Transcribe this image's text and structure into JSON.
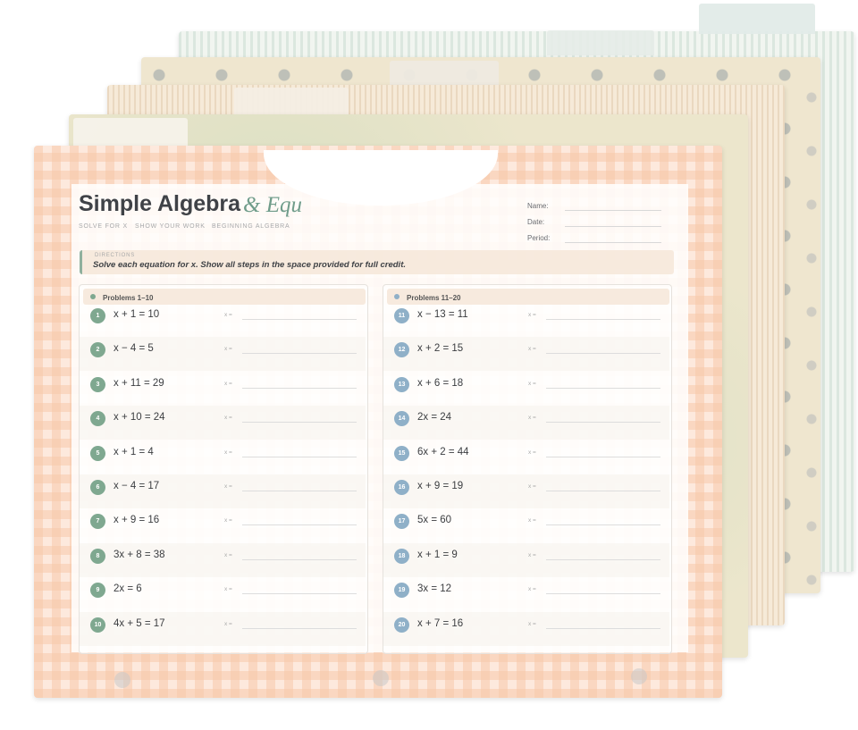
{
  "header": {
    "title": "Simple Algebra",
    "title_accent": "& Equ",
    "subtitle_items": [
      "Solve for x",
      "Show your work",
      "Beginning algebra"
    ],
    "fields": [
      "Name:",
      "Date:",
      "Period:"
    ]
  },
  "directions": {
    "label": "Directions",
    "text": "Solve each equation for x.  Show all steps in the space provided for full credit."
  },
  "colors": {
    "accent_green": "#7fa890",
    "accent_blue": "#8fb0c8"
  },
  "left_column": {
    "heading": "Problems 1–10",
    "problems": [
      {
        "n": "1",
        "eq": "x + 1 = 10",
        "answer_label": "x ="
      },
      {
        "n": "2",
        "eq": "x − 4 = 5",
        "answer_label": "x ="
      },
      {
        "n": "3",
        "eq": "x + 11 = 29",
        "answer_label": "x ="
      },
      {
        "n": "4",
        "eq": "x + 10 = 24",
        "answer_label": "x ="
      },
      {
        "n": "5",
        "eq": "x + 1 = 4",
        "answer_label": "x ="
      },
      {
        "n": "6",
        "eq": "x − 4 = 17",
        "answer_label": "x ="
      },
      {
        "n": "7",
        "eq": "x + 9 = 16",
        "answer_label": "x ="
      },
      {
        "n": "8",
        "eq": "3x + 8 = 38",
        "answer_label": "x ="
      },
      {
        "n": "9",
        "eq": "2x = 6",
        "answer_label": "x ="
      },
      {
        "n": "10",
        "eq": "4x + 5 = 17",
        "answer_label": "x ="
      }
    ]
  },
  "right_column": {
    "heading": "Problems 11–20",
    "problems": [
      {
        "n": "11",
        "eq": "x − 13 = 11",
        "answer_label": "x ="
      },
      {
        "n": "12",
        "eq": "x + 2 = 15",
        "answer_label": "x ="
      },
      {
        "n": "13",
        "eq": "x + 6 = 18",
        "answer_label": "x ="
      },
      {
        "n": "14",
        "eq": "2x = 24",
        "answer_label": "x ="
      },
      {
        "n": "15",
        "eq": "6x + 2 = 44",
        "answer_label": "x ="
      },
      {
        "n": "16",
        "eq": "x + 9 = 19",
        "answer_label": "x ="
      },
      {
        "n": "17",
        "eq": "5x = 60",
        "answer_label": "x ="
      },
      {
        "n": "18",
        "eq": "x + 1 = 9",
        "answer_label": "x ="
      },
      {
        "n": "19",
        "eq": "3x = 12",
        "answer_label": "x ="
      },
      {
        "n": "20",
        "eq": "x + 7 = 16",
        "answer_label": "x ="
      }
    ]
  }
}
